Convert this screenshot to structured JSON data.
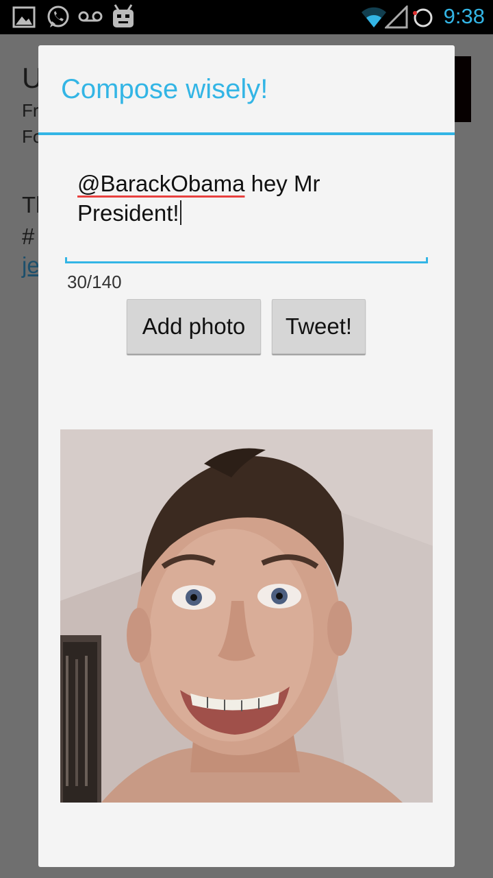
{
  "status_bar": {
    "time": "9:38",
    "icons": [
      "image-icon",
      "whatsapp-icon",
      "voicemail-icon",
      "android-icon",
      "wifi-icon",
      "signal-icon",
      "battery-icon"
    ],
    "accent": "#33b5e5"
  },
  "background_app": {
    "line1": "U",
    "line2": "Fr",
    "line3": "Fo",
    "line4": "Tl",
    "line5": "#",
    "link": "je"
  },
  "dialog": {
    "title": "Compose wisely!",
    "tweet": {
      "mention": "@BarackObama",
      "rest": " hey Mr President!"
    },
    "counter": "30/140",
    "add_photo_label": "Add photo",
    "tweet_label": "Tweet!",
    "photo": "attached-selfie-photo"
  },
  "colors": {
    "accent": "#33b5e5",
    "spellcheck": "#e8403e",
    "dialog_bg": "#f4f4f4",
    "button_bg": "#d6d6d6"
  }
}
